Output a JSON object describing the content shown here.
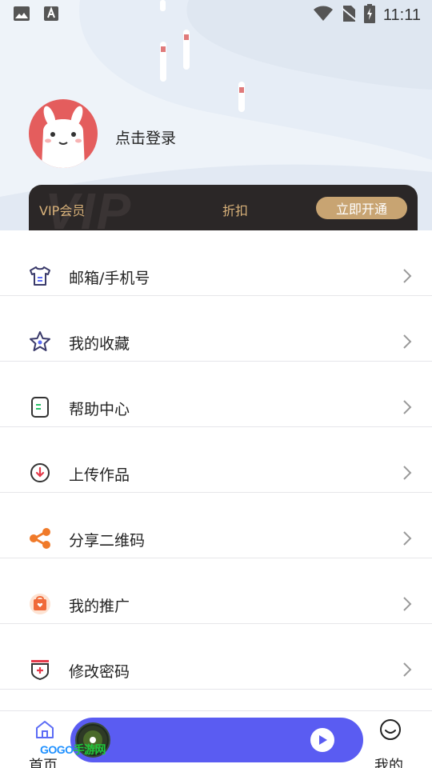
{
  "status_bar": {
    "time": "11:11",
    "icons": [
      "image-icon",
      "font-a-icon",
      "wifi-icon",
      "no-sim-icon",
      "battery-charging-icon"
    ]
  },
  "profile": {
    "login_text": "点击登录",
    "avatar_icon": "alpaca-avatar-icon"
  },
  "vip": {
    "label": "VIP会员",
    "discount": "折扣",
    "button": "立即开通",
    "watermark": "VIP",
    "colors": {
      "card": "#2b2727",
      "gold": "#d9b27a",
      "button": "#c8a472"
    }
  },
  "menu": [
    {
      "label": "邮箱/手机号",
      "icon": "shirt-icon"
    },
    {
      "label": "我的收藏",
      "icon": "star-icon"
    },
    {
      "label": "帮助中心",
      "icon": "notebook-icon"
    },
    {
      "label": "上传作品",
      "icon": "download-circle-icon"
    },
    {
      "label": "分享二维码",
      "icon": "share-icon"
    },
    {
      "label": "我的推广",
      "icon": "promotion-bag-icon"
    },
    {
      "label": "修改密码",
      "icon": "shield-plus-icon"
    }
  ],
  "bottom_nav": {
    "home": "首页",
    "mine": "我的",
    "player_color": "#5a5cf2"
  },
  "watermark": {
    "text": "GOGO",
    "suffix": "手游网"
  }
}
